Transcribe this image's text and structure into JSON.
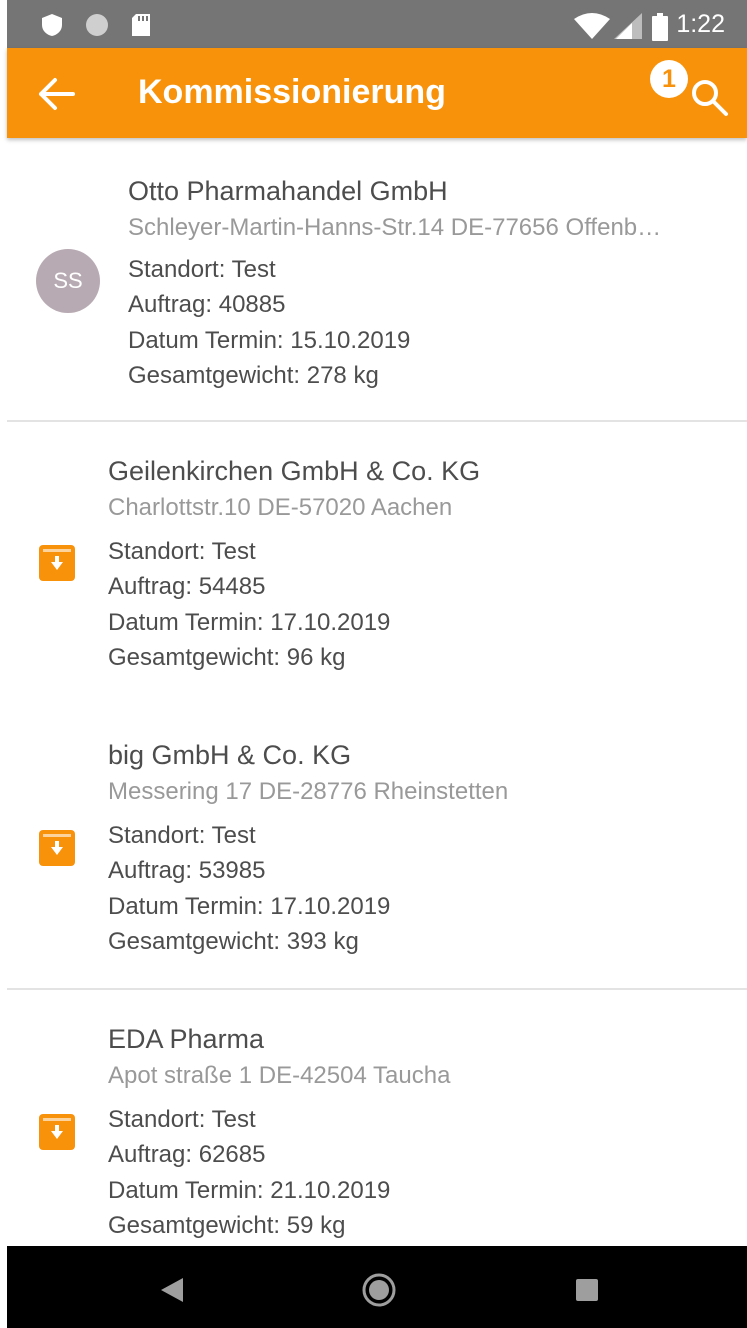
{
  "status_bar": {
    "time": "1:22"
  },
  "app_bar": {
    "title": "Kommissionierung",
    "badge_count": "1",
    "accent_color": "#F7920A"
  },
  "orders": [
    {
      "icon": "avatar",
      "avatar_initials": "SS",
      "name": "Otto Pharmahandel GmbH",
      "address": "Schleyer-Martin-Hanns-Str.14 DE-77656 Offenb…",
      "standort": "Standort:  Test",
      "auftrag": "Auftrag: 40885",
      "datum": "Datum Termin:  15.10.2019",
      "gewicht": "Gesamtgewicht: 278 kg"
    },
    {
      "icon": "archive-download-icon",
      "name": "Geilenkirchen GmbH & Co. KG",
      "address": "Charlottstr.10 DE-57020 Aachen",
      "standort": "Standort:  Test",
      "auftrag": "Auftrag: 54485",
      "datum": "Datum Termin:  17.10.2019",
      "gewicht": "Gesamtgewicht: 96 kg"
    },
    {
      "icon": "archive-download-icon",
      "name": "big GmbH & Co. KG",
      "address": "Messering 17 DE-28776 Rheinstetten",
      "standort": "Standort:  Test",
      "auftrag": "Auftrag: 53985",
      "datum": "Datum Termin:  17.10.2019",
      "gewicht": "Gesamtgewicht: 393 kg"
    },
    {
      "icon": "archive-download-icon",
      "name": "EDA Pharma",
      "address": "Apot straße 1 DE-42504 Taucha",
      "standort": "Standort:  Test",
      "auftrag": "Auftrag: 62685",
      "datum": "Datum Termin:  21.10.2019",
      "gewicht": "Gesamtgewicht: 59 kg"
    }
  ]
}
